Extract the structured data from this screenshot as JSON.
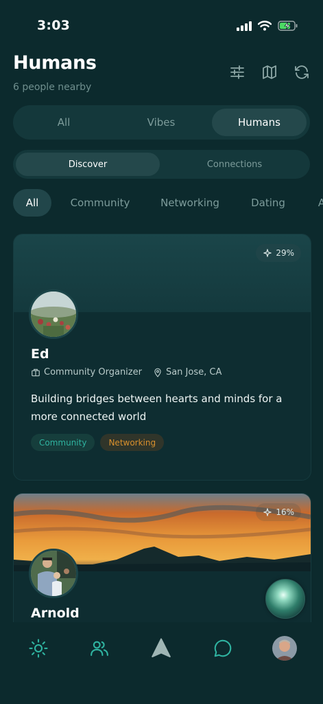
{
  "status_bar": {
    "time": "3:03",
    "icons": [
      "cellular-signal-icon",
      "wifi-icon",
      "battery-charging-icon"
    ]
  },
  "header": {
    "title": "Humans",
    "subtitle": "6 people nearby",
    "actions": [
      "filter-sliders-icon",
      "map-icon",
      "refresh-icon"
    ]
  },
  "main_tabs": [
    {
      "label": "All",
      "active": false
    },
    {
      "label": "Vibes",
      "active": false
    },
    {
      "label": "Humans",
      "active": true
    }
  ],
  "sub_tabs": [
    {
      "label": "Discover",
      "active": true
    },
    {
      "label": "Connections",
      "active": false
    }
  ],
  "filters": [
    {
      "label": "All",
      "active": true
    },
    {
      "label": "Community",
      "active": false
    },
    {
      "label": "Networking",
      "active": false
    },
    {
      "label": "Dating",
      "active": false
    },
    {
      "label": "A",
      "active": false
    }
  ],
  "cards": [
    {
      "name": "Ed",
      "match": "29%",
      "role": "Community Organizer",
      "location": "San Jose, CA",
      "bio": "Building bridges between hearts and minds for a more connected world",
      "tags": [
        "Community",
        "Networking"
      ]
    },
    {
      "name": "Arnold",
      "match": "16%"
    }
  ],
  "bottom_nav": [
    "sun-icon",
    "people-icon",
    "navigation-arrow-icon",
    "chat-bubble-icon",
    "profile-avatar"
  ],
  "colors": {
    "background": "#0c2a2d",
    "card": "#0e2d31",
    "accent_teal": "#2fb3a0",
    "accent_orange": "#d9902d"
  }
}
